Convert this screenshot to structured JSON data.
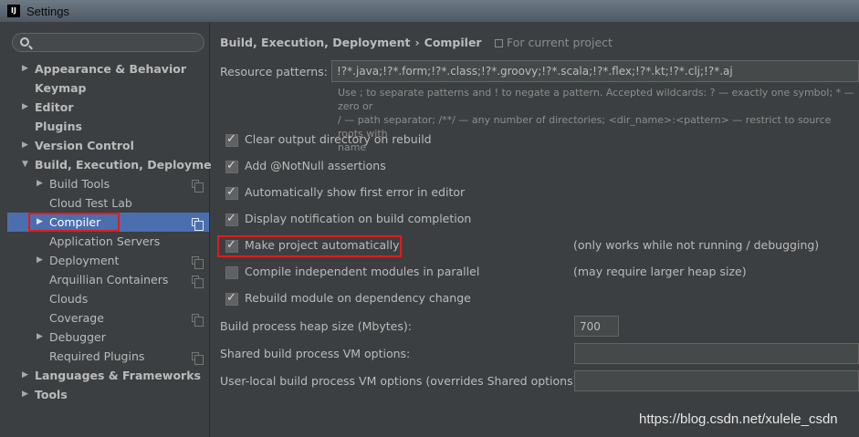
{
  "window": {
    "title": "Settings",
    "app_icon": "IJ"
  },
  "search": {
    "placeholder": ""
  },
  "sidebar": {
    "items": [
      {
        "label": "Appearance & Behavior",
        "bold": true,
        "arrow": "right",
        "level": 0
      },
      {
        "label": "Keymap",
        "bold": true,
        "arrow": "none",
        "level": 0
      },
      {
        "label": "Editor",
        "bold": true,
        "arrow": "right",
        "level": 0
      },
      {
        "label": "Plugins",
        "bold": true,
        "arrow": "none",
        "level": 0
      },
      {
        "label": "Version Control",
        "bold": true,
        "arrow": "right",
        "level": 0
      },
      {
        "label": "Build, Execution, Deployment",
        "bold": true,
        "arrow": "down",
        "level": 0
      },
      {
        "label": "Build Tools",
        "bold": false,
        "arrow": "right",
        "level": 1,
        "project_icon": true
      },
      {
        "label": "Cloud Test Lab",
        "bold": false,
        "arrow": "none",
        "level": 1
      },
      {
        "label": "Compiler",
        "bold": false,
        "arrow": "right",
        "level": 1,
        "project_icon": true,
        "selected": true
      },
      {
        "label": "Application Servers",
        "bold": false,
        "arrow": "none",
        "level": 1
      },
      {
        "label": "Deployment",
        "bold": false,
        "arrow": "right",
        "level": 1,
        "project_icon": true
      },
      {
        "label": "Arquillian Containers",
        "bold": false,
        "arrow": "none",
        "level": 1,
        "project_icon": true
      },
      {
        "label": "Clouds",
        "bold": false,
        "arrow": "none",
        "level": 1
      },
      {
        "label": "Coverage",
        "bold": false,
        "arrow": "none",
        "level": 1,
        "project_icon": true
      },
      {
        "label": "Debugger",
        "bold": false,
        "arrow": "right",
        "level": 1
      },
      {
        "label": "Required Plugins",
        "bold": false,
        "arrow": "none",
        "level": 1,
        "project_icon": true
      },
      {
        "label": "Languages & Frameworks",
        "bold": true,
        "arrow": "right",
        "level": 0
      },
      {
        "label": "Tools",
        "bold": true,
        "arrow": "right",
        "level": 0
      }
    ]
  },
  "breadcrumb": {
    "parent": "Build, Execution, Deployment",
    "separator": "›",
    "current": "Compiler",
    "scope": "For current project"
  },
  "resource_patterns": {
    "label": "Resource patterns:",
    "value": "!?*.java;!?*.form;!?*.class;!?*.groovy;!?*.scala;!?*.flex;!?*.kt;!?*.clj;!?*.aj",
    "hint_line1": "Use ; to separate patterns and ! to negate a pattern. Accepted wildcards: ? — exactly one symbol; * — zero or",
    "hint_line2": "/ — path separator; /**/ — any number of directories; <dir_name>:<pattern> — restrict to source roots with",
    "hint_line3": "name"
  },
  "options": [
    {
      "label": "Clear output directory on rebuild",
      "checked": true,
      "note": ""
    },
    {
      "label": "Add @NotNull assertions",
      "checked": true,
      "note": ""
    },
    {
      "label": "Automatically show first error in editor",
      "checked": true,
      "note": ""
    },
    {
      "label": "Display notification on build completion",
      "checked": true,
      "note": ""
    },
    {
      "label": "Make project automatically",
      "checked": true,
      "note": "(only works while not running / debugging)"
    },
    {
      "label": "Compile independent modules in parallel",
      "checked": false,
      "note": "(may require larger heap size)"
    },
    {
      "label": "Rebuild module on dependency change",
      "checked": true,
      "note": ""
    }
  ],
  "heap": {
    "label": "Build process heap size (Mbytes):",
    "value": "700"
  },
  "shared_vm": {
    "label": "Shared build process VM options:",
    "value": ""
  },
  "local_vm": {
    "label": "User-local build process VM options (overrides Shared options):",
    "value": ""
  },
  "watermark": "https://blog.csdn.net/xulele_csdn",
  "colors": {
    "selection": "#4b6eaf",
    "highlight_box": "#e31a1a",
    "background": "#3c3f41"
  }
}
